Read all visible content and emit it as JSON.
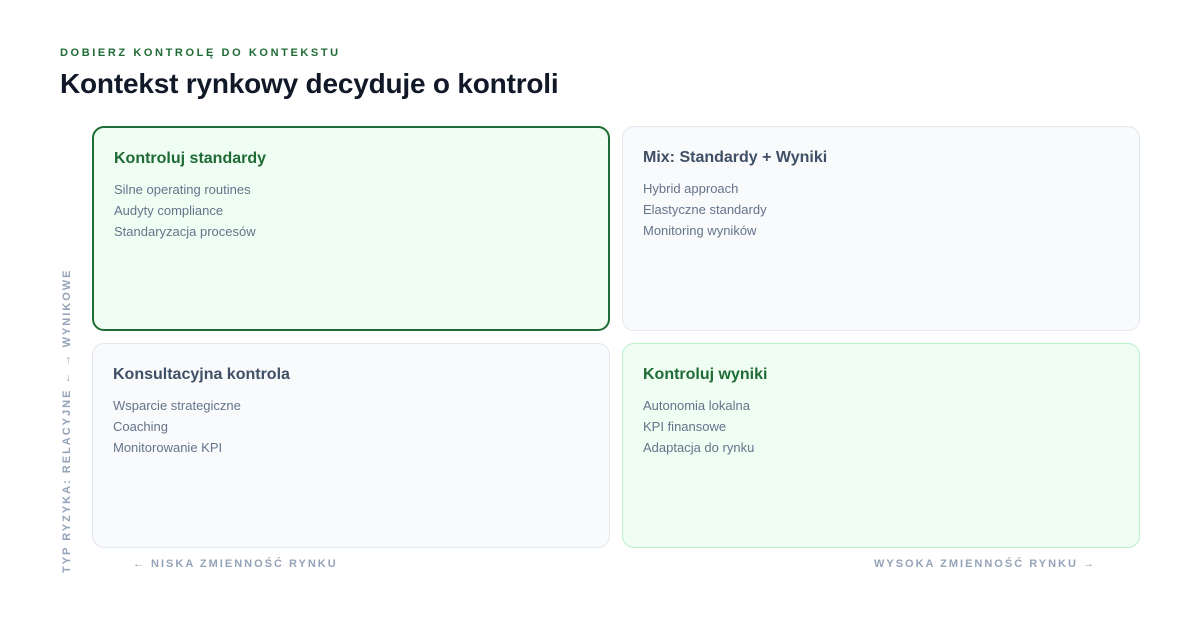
{
  "header": {
    "eyebrow": "DOBIERZ KONTROLĘ DO KONTEKSTU",
    "title": "Kontekst rynkowy decyduje o kontroli"
  },
  "axes": {
    "y_label": "TYP RYZYKA: RELACYJNE ← → WYNIKOWE",
    "x_left": "← NISKA ZMIENNOŚĆ RYNKU",
    "x_right": "WYSOKA ZMIENNOŚĆ RYNKU →"
  },
  "quadrants": [
    {
      "title": "Kontroluj standardy",
      "items": [
        "Silne operating routines",
        "Audyty compliance",
        "Standaryzacja procesów"
      ],
      "state": "active"
    },
    {
      "title": "Mix: Standardy + Wyniki",
      "items": [
        "Hybrid approach",
        "Elastyczne standardy",
        "Monitoring wyników"
      ],
      "state": "neutral"
    },
    {
      "title": "Konsultacyjna kontrola",
      "items": [
        "Wsparcie strategiczne",
        "Coaching",
        "Monitorowanie KPI"
      ],
      "state": "neutral"
    },
    {
      "title": "Kontroluj wyniki",
      "items": [
        "Autonomia lokalna",
        "KPI finansowe",
        "Adaptacja do rynku"
      ],
      "state": "highlight"
    }
  ],
  "colors": {
    "accent": "#1f6b35",
    "active_bg": "#effdf3",
    "neutral_bg": "#f8fafc",
    "muted_text": "#94a3b8"
  }
}
